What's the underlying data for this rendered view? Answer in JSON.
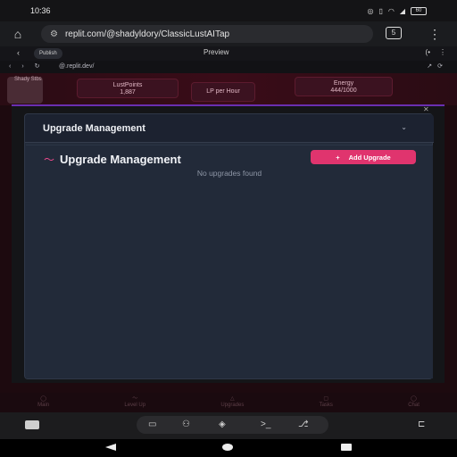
{
  "status_bar": {
    "time": "10:36",
    "battery": "60"
  },
  "browser": {
    "url": "replit.com/@shadyldory/ClassicLustAITap",
    "tab_count": "5"
  },
  "replit_bar": {
    "pill": "Publish",
    "title": "Preview"
  },
  "address": {
    "url": "@.replit.dev/"
  },
  "hud": {
    "player": "Shady Stbs",
    "lustpoints_label": "LustPoints",
    "lustpoints_value": "1,887",
    "lph_label": "LP per Hour",
    "energy_label": "Energy",
    "energy_value": "444/1000"
  },
  "panel": {
    "accordion_title": "Upgrade Management",
    "heading": "Upgrade Management",
    "add_button": "Add Upgrade",
    "add_icon": "+",
    "empty_text": "No upgrades found"
  },
  "bottom_nav": [
    {
      "label": "Main"
    },
    {
      "label": "Level Up"
    },
    {
      "label": "Upgrades"
    },
    {
      "label": "Tasks"
    },
    {
      "label": "Chat"
    }
  ],
  "icons": {
    "home": "home-icon",
    "tune": "tune-icon",
    "kebab": "more-vert-icon",
    "trend": "trending-up-icon",
    "chevron": "chevron-down-icon"
  }
}
